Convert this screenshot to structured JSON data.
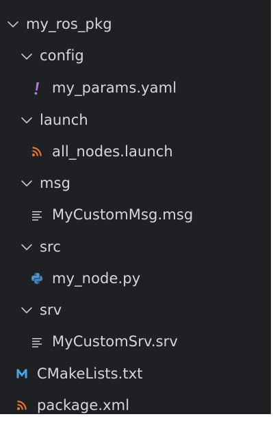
{
  "explorer": {
    "root": {
      "label": "my_ros_pkg"
    },
    "folders": {
      "config": {
        "label": "config"
      },
      "launch": {
        "label": "launch"
      },
      "msg": {
        "label": "msg"
      },
      "src": {
        "label": "src"
      },
      "srv": {
        "label": "srv"
      }
    },
    "files": {
      "params": {
        "label": "my_params.yaml",
        "icon": "exclamation-icon",
        "color": "#b37bde"
      },
      "launch_file": {
        "label": "all_nodes.launch",
        "icon": "rss-icon",
        "color": "#e37933"
      },
      "custom_msg": {
        "label": "MyCustomMsg.msg",
        "icon": "lines-icon",
        "color": "#c5c5c8"
      },
      "node_py": {
        "label": "my_node.py",
        "icon": "python-icon",
        "color": "#4e94ce"
      },
      "custom_srv": {
        "label": "MyCustomSrv.srv",
        "icon": "lines-icon",
        "color": "#c5c5c8"
      },
      "cmake": {
        "label": "CMakeLists.txt",
        "icon": "markdown-m-icon",
        "color": "#4aa6e0"
      },
      "package_xml": {
        "label": "package.xml",
        "icon": "rss-icon",
        "color": "#e37933"
      }
    }
  },
  "colors": {
    "background": "#1f2023",
    "text": "#d7d7d9",
    "chevron": "#c8c8cb"
  }
}
